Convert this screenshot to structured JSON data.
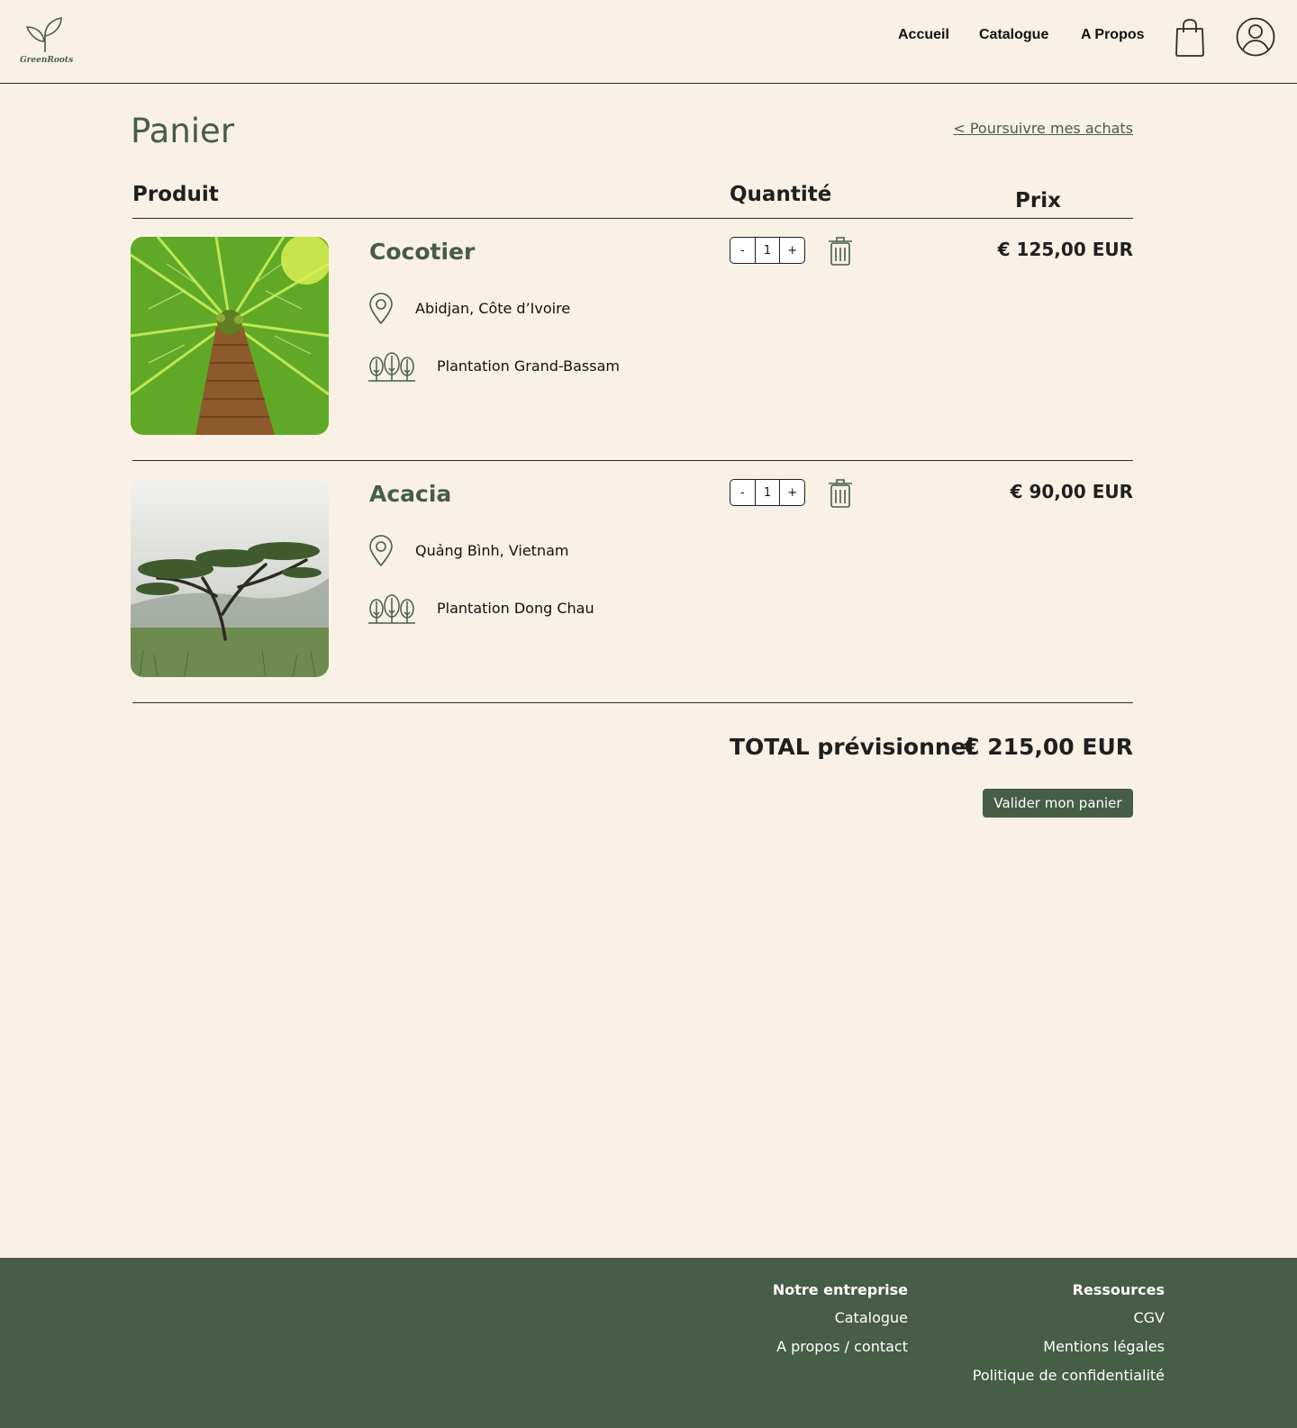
{
  "header": {
    "logo_text": "GreenRoots",
    "nav": [
      "Accueil",
      "Catalogue",
      "A Propos"
    ]
  },
  "page": {
    "title": "Panier",
    "continue_link": "< Poursuivre mes achats",
    "columns": {
      "product": "Produit",
      "quantity": "Quantité",
      "price": "Prix"
    }
  },
  "items": [
    {
      "name": "Cocotier",
      "location": "Abidjan, Côte d’Ivoire",
      "plantation": "Plantation Grand-Bassam",
      "quantity": "1",
      "minus": "-",
      "plus": "+",
      "price": "€ 125,00 EUR",
      "image": "palm-tree-photo"
    },
    {
      "name": "Acacia",
      "location": "Quảng Bình, Vietnam",
      "plantation": "Plantation Dong Chau",
      "quantity": "1",
      "minus": "-",
      "plus": "+",
      "price": "€ 90,00 EUR",
      "image": "acacia-tree-photo"
    }
  ],
  "summary": {
    "total_label": "TOTAL prévisionnel",
    "total_value": "€ 215,00 EUR",
    "validate_label": "Valider mon panier"
  },
  "footer": {
    "col1": {
      "heading": "Notre entreprise",
      "links": [
        "Catalogue",
        "A propos / contact"
      ]
    },
    "col2": {
      "heading": "Ressources",
      "links": [
        "CGV",
        "Mentions légales",
        "Politique de confidentialité"
      ]
    }
  },
  "colors": {
    "background": "#f9f1e5",
    "brand_green": "#465d46",
    "text": "#1f1f1f"
  },
  "icons": [
    "sprout-logo-icon",
    "shopping-bag-icon",
    "user-icon",
    "location-pin-icon",
    "forest-icon",
    "trash-icon"
  ]
}
